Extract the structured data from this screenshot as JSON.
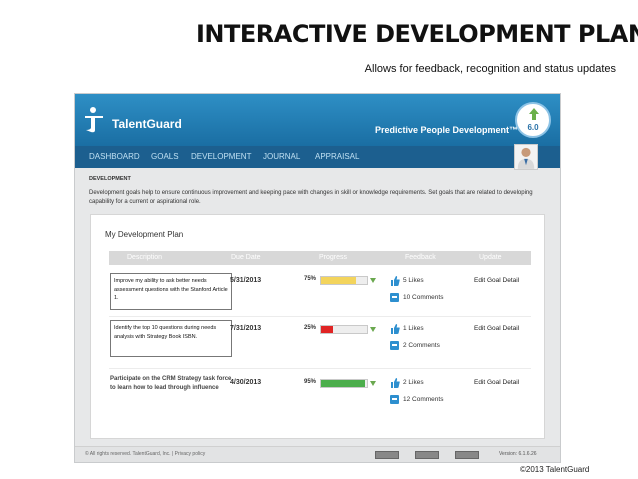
{
  "slide": {
    "title": "INTERACTIVE DEVELOPMENT PLAN",
    "subtitle": "Allows for feedback, recognition and status updates",
    "copyright": "©2013 TalentGuard"
  },
  "app": {
    "brand": "TalentGuard",
    "tagline": "Predictive People Development™",
    "version_badge": "6.0",
    "nav": [
      "DASHBOARD",
      "GOALS",
      "DEVELOPMENT",
      "JOURNAL",
      "APPRAISAL"
    ],
    "section_label": "DEVELOPMENT",
    "intro": "Development goals help to ensure continuous improvement and keeping pace with changes in skill or knowledge requirements. Set goals that are related to developing capability for a current or aspirational role.",
    "panel_title": "My Development Plan",
    "columns": [
      "Description",
      "Due Date",
      "Progress",
      "Feedback",
      "Update"
    ],
    "goals": [
      {
        "description": "Improve my ability to ask better needs assessment questions with the Stanford Article 1.",
        "due": "5/31/2013",
        "progress_label": "75%",
        "progress": 75,
        "bar_color": "#f3d45c",
        "likes": "5 Likes",
        "comments": "10 Comments",
        "action": "Edit Goal Detail",
        "boxed": true
      },
      {
        "description": "Identify the top 10 questions during needs analysis with Strategy Book ISBN.",
        "due": "7/31/2013",
        "progress_label": "25%",
        "progress": 25,
        "bar_color": "#e02424",
        "likes": "1 Likes",
        "comments": "2 Comments",
        "action": "Edit Goal Detail",
        "boxed": true
      },
      {
        "description": "Participate on the CRM Strategy task force to learn how to lead through influence",
        "due": "4/30/2013",
        "progress_label": "95%",
        "progress": 95,
        "bar_color": "#4cae4c",
        "likes": "2 Likes",
        "comments": "12 Comments",
        "action": "Edit Goal Detail",
        "boxed": false
      }
    ],
    "footer_copy": "© All rights reserved. TalentGuard, Inc. | Privacy policy",
    "footer_version": "Version: 6.1.6.26"
  },
  "colors": {
    "header": "#2e8fc5",
    "nav": "#1c5f8f",
    "panel_bg": "#e7e8e9",
    "icon_blue": "#2d8fcf"
  },
  "icons": {
    "logo": "talentguard-logo-icon",
    "cloud": "cloud-upload-icon",
    "thumb": "thumbs-up-icon",
    "comment": "comment-icon",
    "avatar": "user-avatar-icon",
    "caret": "caret-down-icon"
  }
}
